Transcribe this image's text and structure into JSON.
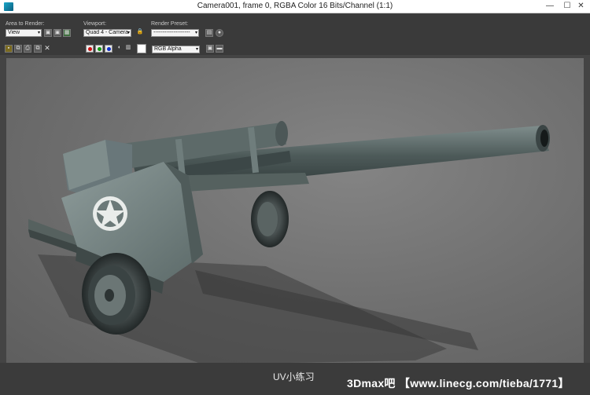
{
  "window": {
    "title": "Camera001, frame 0, RGBA Color 16 Bits/Channel (1:1)",
    "minimize_glyph": "—",
    "maximize_glyph": "☐",
    "close_glyph": "✕"
  },
  "toolbar": {
    "area_to_render": {
      "label": "Area to Render:",
      "value": "View"
    },
    "viewport": {
      "label": "Viewport:",
      "value": "Quad 4 - Camera"
    },
    "render_preset": {
      "label": "Render Preset:",
      "value": "--------------------"
    },
    "channel_display": {
      "value": "RGB Alpha"
    },
    "channel_colors": {
      "red": "#d01010",
      "green": "#119a11",
      "blue": "#1030c8"
    }
  },
  "caption": "UV小练习",
  "watermark": "3Dmax吧 【www.linecg.com/tieba/1771】",
  "colors": {
    "toolbar_bg": "#3a3a3a",
    "viewport_bg": "#737373",
    "caption_bg": "#3b3b3b"
  }
}
